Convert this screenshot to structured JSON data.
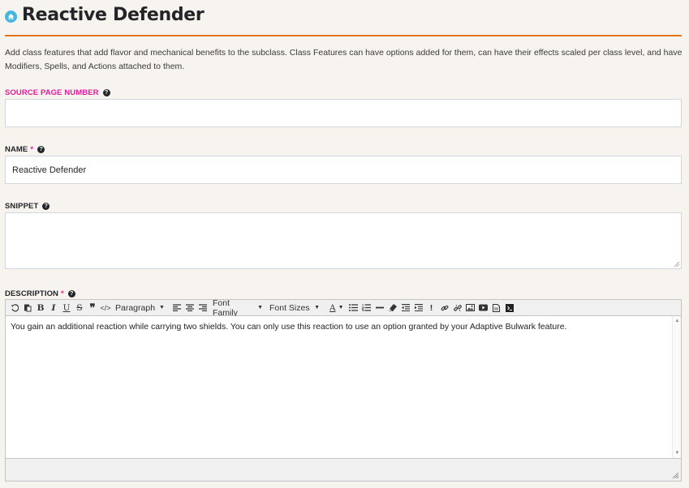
{
  "header": {
    "icon": "home-icon",
    "title": "Reactive Defender",
    "accent_color": "#e6741b"
  },
  "intro": "Add class features that add flavor and mechanical benefits to the subclass. Class Features can have options added for them, can have their effects scaled per class level, and have Modifiers, Spells, and Actions attached to them.",
  "fields": {
    "source_page": {
      "label": "SOURCE PAGE NUMBER",
      "value": "",
      "help_icon": "question-circle-icon"
    },
    "name": {
      "label": "NAME",
      "required_mark": "*",
      "value": "Reactive Defender"
    },
    "snippet": {
      "label": "SNIPPET",
      "value": ""
    },
    "description": {
      "label": "DESCRIPTION",
      "required_mark": "*",
      "value": "You gain an additional reaction while carrying two shields. You can only use this reaction to use an option granted by your Adaptive Bulwark feature."
    }
  },
  "toolbar": {
    "bold": "B",
    "italic": "I",
    "underline": "U",
    "strike": "S",
    "quote": "❞",
    "code": "</>",
    "format_select": "Paragraph",
    "font_family_select": "Font Family",
    "font_size_select": "Font Sizes",
    "text_color": "A",
    "blockquote_mark": "!"
  },
  "colors": {
    "label_pink": "#e7199b",
    "border": "#cfd7e0"
  }
}
